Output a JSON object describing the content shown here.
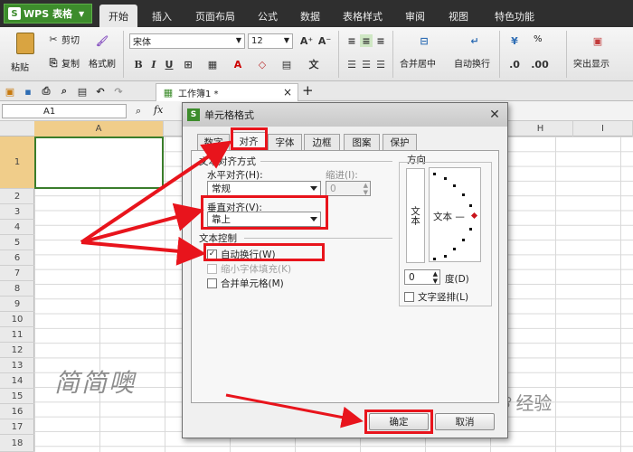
{
  "app": {
    "logo": "WPS 表格",
    "menu_tabs": [
      "开始",
      "插入",
      "页面布局",
      "公式",
      "数据",
      "表格样式",
      "审阅",
      "视图",
      "特色功能"
    ]
  },
  "ribbon": {
    "paste": "粘贴",
    "cut": "剪切",
    "copy": "复制",
    "format_painter": "格式刷",
    "font_name": "宋体",
    "font_size": "12",
    "merge_center": "合并居中",
    "wrap_text": "自动换行",
    "highlight": "突出显示",
    "percent": "%"
  },
  "doc_tab": {
    "title": "工作簿1 *"
  },
  "formula_bar": {
    "cell_ref": "A1",
    "fx": "fx"
  },
  "sheet": {
    "columns": [
      "A",
      "H",
      "I"
    ],
    "rows": [
      "1",
      "2",
      "3",
      "4",
      "5",
      "6",
      "7",
      "8",
      "9",
      "10",
      "11",
      "12",
      "13",
      "14",
      "15",
      "16",
      "17",
      "18"
    ],
    "watermark": "简简噢",
    "jingyan": "经验"
  },
  "dialog": {
    "title": "单元格格式",
    "tabs": [
      "数字",
      "对齐",
      "字体",
      "边框",
      "图案",
      "保护"
    ],
    "active_tab": "对齐",
    "text_align_section": "文本对齐方式",
    "horizontal_label": "水平对齐(H):",
    "horizontal_value": "常规",
    "indent_label": "缩进(I):",
    "indent_value": "0",
    "vertical_label": "垂直对齐(V):",
    "vertical_value": "靠上",
    "text_control_section": "文本控制",
    "wrap_label": "自动换行(W)",
    "wrap_checked": true,
    "shrink_label": "缩小字体填充(K)",
    "merge_label": "合并单元格(M)",
    "orientation_section": "方向",
    "vertical_text": "文本",
    "orientation_text": "文本 —",
    "degree_value": "0",
    "degree_label": "度(D)",
    "vertical_stack_label": "文字竖排(L)",
    "ok": "确定",
    "cancel": "取消"
  },
  "colors": {
    "annotation_red": "#e8141c",
    "wps_green": "#3d8c2c"
  }
}
